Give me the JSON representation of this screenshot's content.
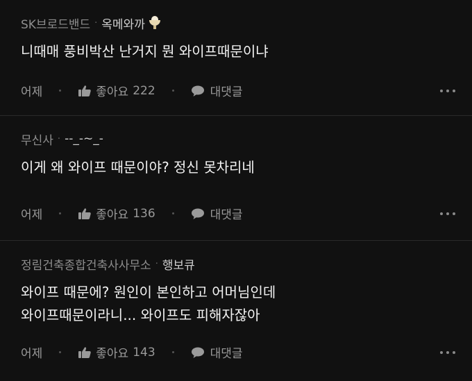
{
  "comments": [
    {
      "company": "SK브로드밴드",
      "separator": "·",
      "nickname": "옥메와까",
      "text_lines": [
        "니때매 풍비박산 난거지 뭔 와이프때문이냐"
      ],
      "time": "어제",
      "like_label": "좋아요",
      "like_count": "222",
      "reply_label": "대댓글"
    },
    {
      "company": "무신사",
      "separator": "·",
      "nickname": "--_-~_-",
      "text_lines": [
        "이게 왜 와이프 때문이야? 정신 못차리네"
      ],
      "time": "어제",
      "like_label": "좋아요",
      "like_count": "136",
      "reply_label": "대댓글"
    },
    {
      "company": "정림건축종합건축사사무소",
      "separator": "·",
      "nickname": "행보큐",
      "text_lines": [
        "와이프 때문에? 원인이 본인하고 어머님인데",
        "와이프때문이라니... 와이프도 피해자잖아"
      ],
      "time": "어제",
      "like_label": "좋아요",
      "like_count": "143",
      "reply_label": "대댓글"
    }
  ]
}
